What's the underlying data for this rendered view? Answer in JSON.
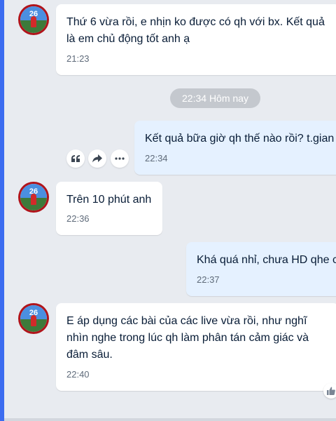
{
  "conversation": {
    "messages": [
      {
        "text": "Thứ 6 vừa rồi, e nhịn ko được có qh với bx. Kết quả\nlà em chủ động tốt anh ạ",
        "time": "21:23"
      },
      {
        "text": "Kết quả bữa giờ qh thế nào rồi? t.gian",
        "time": "22:34"
      },
      {
        "text": "Trên 10 phút anh",
        "time": "22:36"
      },
      {
        "text": "Khá quá nhỉ, chưa HD qhe c",
        "time": "22:37"
      },
      {
        "text": "E áp dụng các bài của các live vừa rồi, như nghĩ\nnhìn nghe trong lúc qh làm phân tán cảm giác và\nđâm sâu.",
        "time": "22:40"
      }
    ],
    "date_separator": "22:34 Hôm nay",
    "avatar_number": "26"
  },
  "icons": {
    "quote": "quote-icon",
    "share": "share-icon",
    "more": "more-icon",
    "reaction": "thumbs-up-icon"
  },
  "colors": {
    "accent": "#3c6cf0",
    "incoming_bubble": "#ffffff",
    "outgoing_bubble": "#e5f1ff",
    "background": "#e8ebf0"
  }
}
